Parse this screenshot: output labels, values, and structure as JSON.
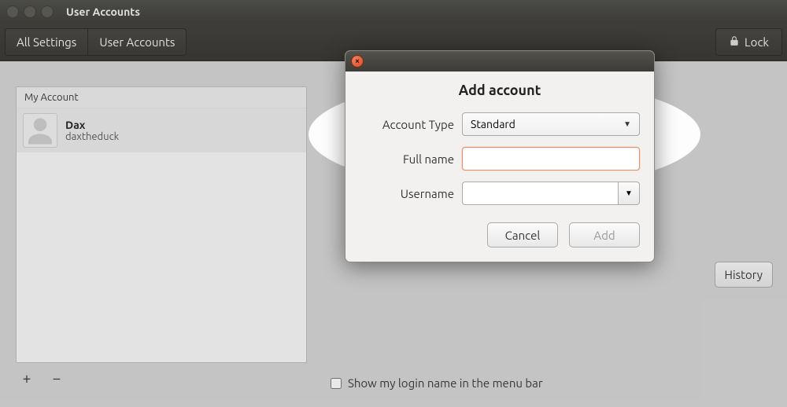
{
  "window": {
    "title": "User Accounts"
  },
  "toolbar": {
    "all_settings": "All Settings",
    "user_accounts": "User Accounts",
    "lock": "Lock"
  },
  "sidebar": {
    "header": "My Account",
    "accounts": [
      {
        "display_name": "Dax",
        "username": "daxtheduck"
      }
    ]
  },
  "main": {
    "history_button": "History",
    "show_login_label": "Show my login name in the menu bar",
    "show_login_checked": false
  },
  "dialog": {
    "title": "Add account",
    "labels": {
      "account_type": "Account Type",
      "full_name": "Full name",
      "username": "Username"
    },
    "account_type_value": "Standard",
    "full_name_value": "",
    "username_value": "",
    "buttons": {
      "cancel": "Cancel",
      "add": "Add"
    }
  }
}
